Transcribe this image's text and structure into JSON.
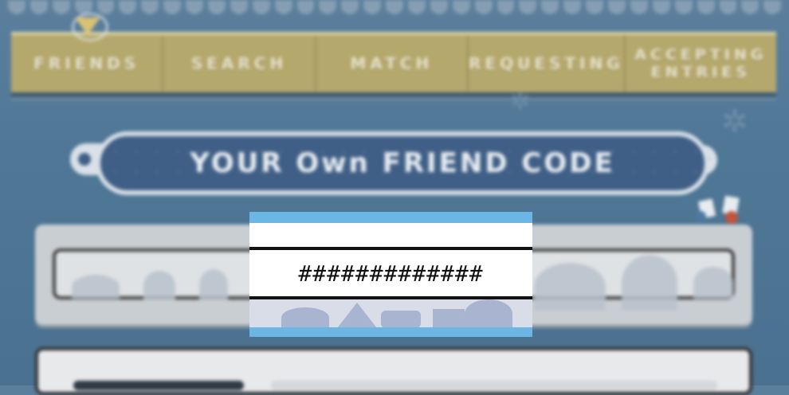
{
  "nav": {
    "tabs": [
      {
        "label": "FRIENDS",
        "selected": true
      },
      {
        "label": "SEARCH",
        "selected": false
      },
      {
        "label": "MATCH",
        "selected": false
      },
      {
        "label": "REQUESTING",
        "selected": false
      },
      {
        "label": "ACCEPTING ENTRIES",
        "selected": false
      }
    ]
  },
  "banner": {
    "title": "YOUR Own FRIEND CODE"
  },
  "friend_code": {
    "value": "#############"
  },
  "colors": {
    "background": "#4f7796",
    "nav_bar": "#b5a86c",
    "banner": "#3f5f86",
    "overlay_accent": "#6cb6e6"
  }
}
